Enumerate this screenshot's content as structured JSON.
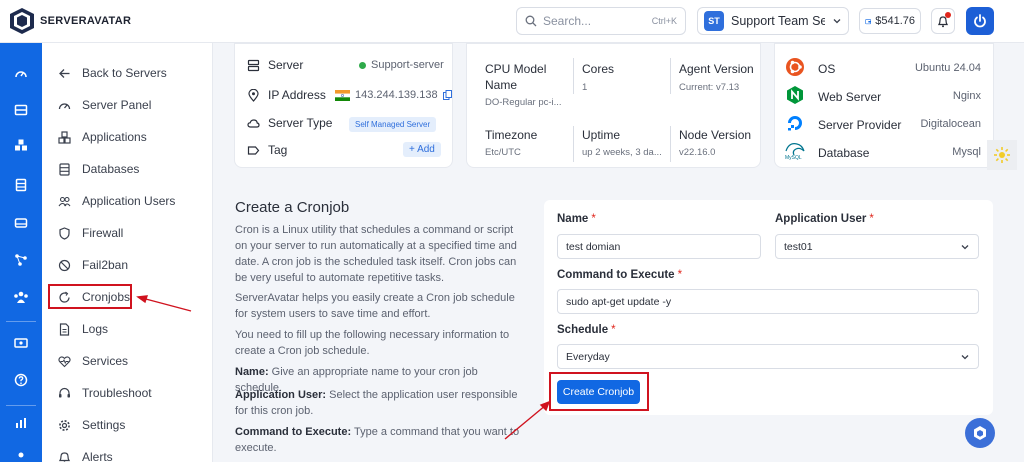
{
  "header": {
    "logo_text": "SERVERAVATAR",
    "search_placeholder": "Search...",
    "search_shortcut": "Ctrl+K",
    "team_initials": "ST",
    "team_name": "Support Team Se...",
    "credit": "$541.76"
  },
  "sidebar": {
    "items": [
      {
        "label": "Back to Servers",
        "icon": "arrow-left-icon"
      },
      {
        "label": "Server Panel",
        "icon": "gauge-icon"
      },
      {
        "label": "Applications",
        "icon": "cubes-icon"
      },
      {
        "label": "Databases",
        "icon": "database-icon"
      },
      {
        "label": "Application Users",
        "icon": "users-icon"
      },
      {
        "label": "Firewall",
        "icon": "shield-icon"
      },
      {
        "label": "Fail2ban",
        "icon": "ban-icon"
      },
      {
        "label": "Cronjobs",
        "icon": "refresh-icon"
      },
      {
        "label": "Logs",
        "icon": "file-icon"
      },
      {
        "label": "Services",
        "icon": "heart-pulse-icon"
      },
      {
        "label": "Troubleshoot",
        "icon": "headset-icon"
      },
      {
        "label": "Settings",
        "icon": "gear-icon"
      },
      {
        "label": "Alerts",
        "icon": "bell-icon"
      }
    ]
  },
  "server_card": {
    "server_label": "Server",
    "server_value": "Support-server",
    "ip_label": "IP Address",
    "ip_value": "143.244.139.138",
    "type_label": "Server Type",
    "type_value": "Self Managed Server",
    "tag_label": "Tag",
    "tag_action": "+ Add"
  },
  "specs_card": {
    "cpu_label": "CPU Model Name",
    "cpu_value": "DO-Regular pc-i...",
    "cores_label": "Cores",
    "cores_value": "1",
    "agent_label": "Agent Version",
    "agent_value": "Current: v7.13",
    "timezone_label": "Timezone",
    "timezone_value": "Etc/UTC",
    "uptime_label": "Uptime",
    "uptime_value": "up 2 weeks, 3 da...",
    "node_label": "Node Version",
    "node_value": "v22.16.0"
  },
  "stack_card": {
    "os_label": "OS",
    "os_value": "Ubuntu 24.04",
    "web_label": "Web Server",
    "web_value": "Nginx",
    "provider_label": "Server Provider",
    "provider_value": "Digitalocean",
    "db_label": "Database",
    "db_value": "Mysql",
    "mysql_logo_text": "MySQL"
  },
  "cron": {
    "title": "Create a Cronjob",
    "p1": "Cron is a Linux utility that schedules a command or script on your server to run automatically at a specified time and date. A cron job is the scheduled task itself. Cron jobs can be very useful to automate repetitive tasks.",
    "p2": "ServerAvatar helps you easily create a Cron job schedule for system users to save time and effort.",
    "p3": "You need to fill up the following necessary information to create a Cron job schedule.",
    "p4_label": "Name:",
    "p4_text": " Give an appropriate name to your cron job schedule.",
    "p5_label": "Application User:",
    "p5_text": " Select the application user responsible for this cron job.",
    "p6_label": "Command to Execute:",
    "p6_text": " Type a command that you want to execute."
  },
  "form": {
    "name_label": "Name",
    "name_value": "test domian",
    "user_label": "Application User",
    "user_value": "test01",
    "command_label": "Command to Execute",
    "command_value": "sudo apt-get update -y",
    "schedule_label": "Schedule",
    "schedule_value": "Everyday",
    "required_mark": "*",
    "submit_label": "Create Cronjob"
  },
  "colors": {
    "primary": "#1168e3",
    "highlight": "#d0131f",
    "online": "#2eaa4a"
  }
}
